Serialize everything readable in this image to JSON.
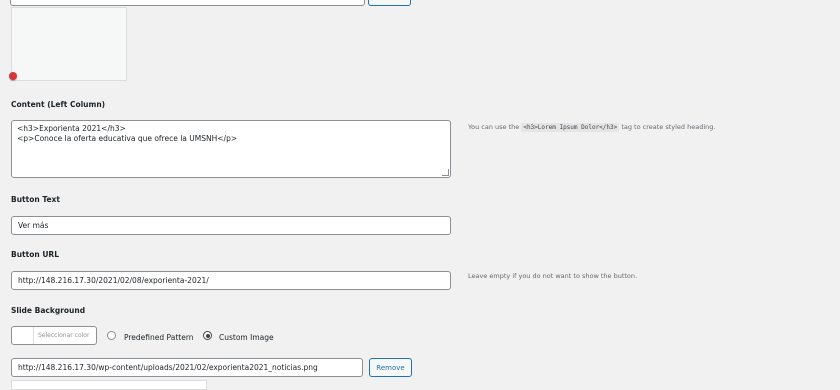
{
  "content_left": {
    "label": "Content (Left Column)",
    "line1": "<h3>Exporienta 2021</h3>",
    "line2": "<p>Conoce la oferta educativa que ofrece la UMSNH</p>",
    "hint_prefix": "You can use the ",
    "hint_code": "<h3>Lorem Ipsum Dolor</h3>",
    "hint_suffix": " tag to create styled heading."
  },
  "button_text": {
    "label": "Button Text",
    "value": "Ver más"
  },
  "button_url": {
    "label": "Button URL",
    "value": "http://148.216.17.30/2021/02/08/exporienta-2021/",
    "hint": "Leave empty if you do not want to show the button."
  },
  "slide_background": {
    "label": "Slide Background",
    "color_button": "Seleccionar color",
    "option_pattern": "Predefined Pattern",
    "option_custom": "Custom Image",
    "selected": "Custom Image",
    "image_url": "http://148.216.17.30/wp-content/uploads/2021/02/exporienta2021_noticias.png",
    "remove_label": "Remove"
  },
  "colors": {
    "accent": "#2271b1",
    "danger": "#d63638"
  }
}
